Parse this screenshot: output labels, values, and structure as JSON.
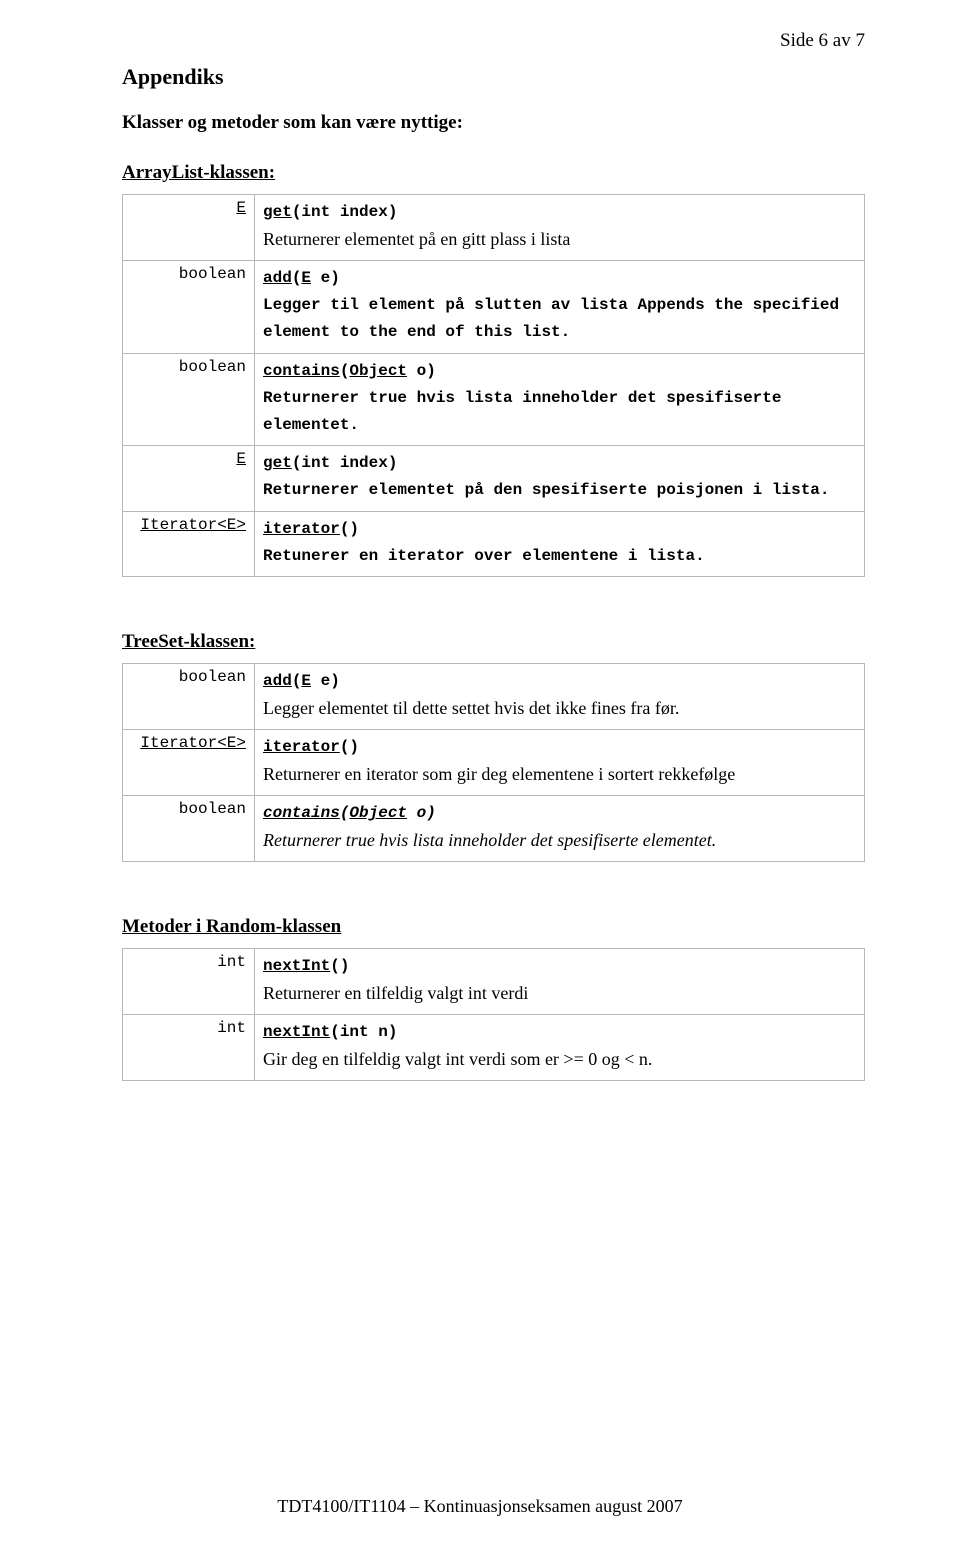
{
  "page_number": "Side 6 av 7",
  "appendix_title": "Appendiks",
  "classes_lead": "Klasser og metoder som kan være nyttige:",
  "arraylist": {
    "heading": "ArrayList-klassen:",
    "rows": [
      {
        "ret": "E",
        "ret_underline": true,
        "sig_name": "get",
        "sig_args": "(int index)",
        "desc": "Returnerer elementet på en gitt plass i lista",
        "desc_style": "times"
      },
      {
        "ret": "boolean",
        "sig_name": "add",
        "sig_args": "(E e)",
        "sig_arg_underline": "E",
        "desc": "Legger til element på slutten av lista     Appends the specified element to the end of this list.",
        "desc_style": "monobold"
      },
      {
        "ret": "boolean",
        "sig_name": "contains",
        "sig_args": "(Object o)",
        "sig_arg_underline": "Object",
        "desc": "Returnerer true hvis lista inneholder det spesifiserte elementet.",
        "desc_style": "monobold"
      },
      {
        "ret": "E",
        "ret_underline": true,
        "sig_name": "get",
        "sig_args": "(int index)",
        "desc": "Returnerer elementet på den spesifiserte poisjonen i lista.",
        "desc_style": "monobold"
      },
      {
        "ret": "Iterator<E>",
        "ret_underline": true,
        "sig_name": "iterator",
        "sig_args": "()",
        "desc": "Retunerer en iterator over elementene i lista.",
        "desc_style": "monobold"
      }
    ]
  },
  "treeset": {
    "heading": "TreeSet-klassen:",
    "rows": [
      {
        "ret": "boolean",
        "sig_name": "add",
        "sig_args": "(E e)",
        "sig_arg_underline": "E",
        "desc": "Legger elementet til dette settet hvis det ikke fines fra før.",
        "desc_style": "times"
      },
      {
        "ret": "Iterator<E>",
        "ret_underline": true,
        "sig_name": "iterator",
        "sig_args": "()",
        "desc": "Returnerer en iterator som gir deg elementene i sortert rekkefølge",
        "desc_style": "times"
      },
      {
        "ret": "boolean",
        "sig_italic": true,
        "sig_name": "contains",
        "sig_args": "(Object o)",
        "sig_arg_underline": "Object",
        "desc": "Returnerer true hvis lista inneholder det spesifiserte elementet.",
        "desc_style": "times_italic"
      }
    ]
  },
  "random": {
    "heading": "Metoder i Random-klassen",
    "rows": [
      {
        "ret": "int",
        "sig_name": "nextInt",
        "sig_args": "()",
        "desc": "Returnerer en tilfeldig valgt int verdi",
        "desc_style": "times"
      },
      {
        "ret": "int",
        "sig_name": "nextInt",
        "sig_args": "(int n)",
        "desc": "Gir deg en tilfeldig valgt int verdi som er >= 0 og < n.",
        "desc_style": "times"
      }
    ]
  },
  "footer": "TDT4100/IT1104 – Kontinuasjonseksamen august 2007"
}
